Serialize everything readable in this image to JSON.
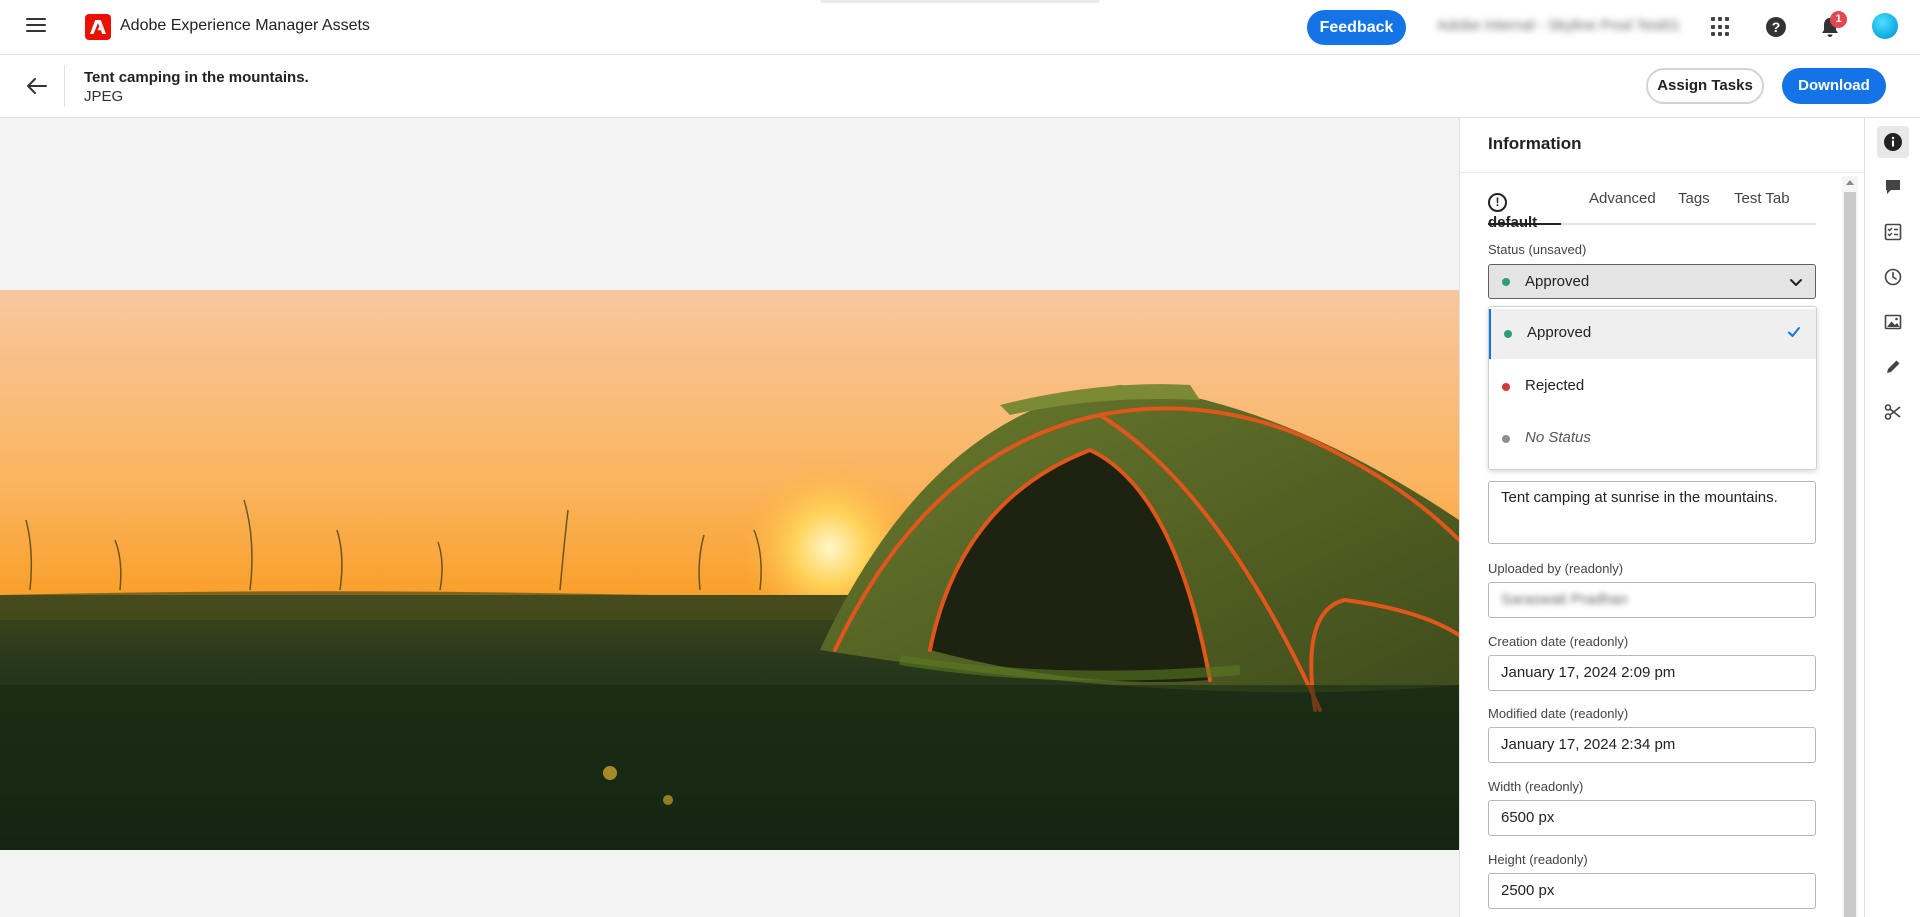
{
  "app": {
    "title": "Adobe Experience Manager Assets",
    "feedback_label": "Feedback",
    "org_name": "Adobe Internal - Skyline Prod Test01",
    "notification_count": "1",
    "colors": {
      "accent": "#1473e6",
      "adobe_red": "#eb1000",
      "badge": "#e34850"
    }
  },
  "asset": {
    "title": "Tent camping in the mountains.",
    "type": "JPEG",
    "assign_tasks_label": "Assign Tasks",
    "download_label": "Download"
  },
  "info_panel": {
    "title": "Information",
    "tabs": [
      {
        "label": "default",
        "active": true,
        "icon": "alert-icon"
      },
      {
        "label": "Advanced"
      },
      {
        "label": "Tags"
      },
      {
        "label": "Test Tab"
      }
    ],
    "status": {
      "label": "Status (unsaved)",
      "value": "Approved",
      "options": [
        {
          "label": "Approved",
          "color": "#2d9d78",
          "selected": true
        },
        {
          "label": "Rejected",
          "color": "#d7373f"
        },
        {
          "label": "No Status",
          "color": "#8e8e8e"
        }
      ]
    },
    "description": {
      "value": "Tent camping at sunrise in the mountains."
    },
    "uploaded_by": {
      "label": "Uploaded by (readonly)",
      "value": "Saraswati Pradhan"
    },
    "creation_date": {
      "label": "Creation date (readonly)",
      "value": "January 17, 2024 2:09 pm"
    },
    "modified_date": {
      "label": "Modified date (readonly)",
      "value": "January 17, 2024 2:34 pm"
    },
    "width": {
      "label": "Width (readonly)",
      "value": "6500 px"
    },
    "height": {
      "label": "Height (readonly)",
      "value": "2500 px"
    }
  },
  "rail": {
    "items": [
      "info-icon",
      "comment-icon",
      "tasks-icon",
      "history-icon",
      "renditions-icon",
      "edit-icon",
      "cut-icon"
    ]
  }
}
